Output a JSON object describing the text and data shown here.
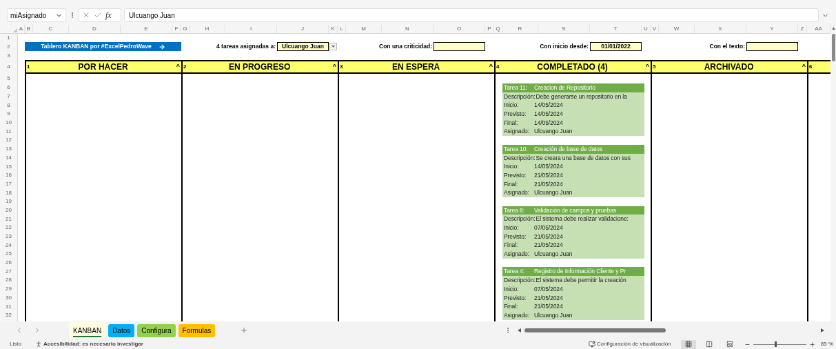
{
  "name_box": "miAsignado",
  "formula_bar": {
    "function_label": "fx",
    "value": "Ulcuango Juan"
  },
  "column_headers": [
    "A",
    "B",
    "C",
    "D",
    "E",
    "F",
    "G",
    "H",
    "I",
    "J",
    "K",
    "L",
    "M",
    "N",
    "O",
    "P",
    "Q",
    "R",
    "S",
    "T",
    "U",
    "V",
    "W",
    "X",
    "Y",
    "Z",
    "AA"
  ],
  "row_headers": [
    "1",
    "2",
    "3",
    "4",
    "5",
    "6",
    "7",
    "8",
    "9",
    "10",
    "11",
    "12",
    "13",
    "14",
    "15",
    "16",
    "17",
    "18",
    "19",
    "20",
    "21",
    "22",
    "23",
    "24",
    "25",
    "26",
    "27",
    "28",
    "29",
    "30",
    "31",
    "32"
  ],
  "banner": "Tablero KANBAN por #ExcelPedroWave",
  "filters": [
    {
      "kind": "dropdown",
      "label": "4 tareas asignadas a:",
      "value": "Ulcuango Juan"
    },
    {
      "kind": "field",
      "label": "Con una criticidad:"
    },
    {
      "kind": "field",
      "label": "Con inicio desde:",
      "value": "01/01/2022"
    },
    {
      "kind": "field",
      "label": "Con el texto:"
    }
  ],
  "board": [
    {
      "number": "1",
      "title": "POR HACER",
      "toggle": "^"
    },
    {
      "number": "2",
      "title": "EN PROGRESO",
      "toggle": "^"
    },
    {
      "number": "3",
      "title": "EN ESPERA",
      "toggle": "^"
    },
    {
      "number": "4",
      "title": "COMPLETADO (4)",
      "toggle": "^",
      "cards": [
        {
          "task": "Tarea 11:",
          "title": "Creacion de Repositorio",
          "fields": [
            {
              "label": "Descripción:",
              "value": "Debe generarse un repositorio en la"
            },
            {
              "label": "Inicio:",
              "value": "14/05/2024"
            },
            {
              "label": "Previsto:",
              "value": "14/05/2024"
            },
            {
              "label": "Final:",
              "value": "14/05/2024"
            },
            {
              "label": "Asignado:",
              "value": "Ulcuango Juan"
            }
          ]
        },
        {
          "task": "Tarea 10:",
          "title": "Creación de base de datos",
          "fields": [
            {
              "label": "Descripción:",
              "value": "Se creara una base de datos con sus"
            },
            {
              "label": "Inicio:",
              "value": "14/05/2024"
            },
            {
              "label": "Previsto:",
              "value": "21/05/2024"
            },
            {
              "label": "Final:",
              "value": "21/05/2024"
            },
            {
              "label": "Asignado:",
              "value": "Ulcuango Juan"
            }
          ]
        },
        {
          "task": "Tarea 8:",
          "title": "Validación de campos y pruebas",
          "fields": [
            {
              "label": "Descripción:",
              "value": "El sistema debe realizar validacione:"
            },
            {
              "label": "Inicio:",
              "value": "07/05/2024"
            },
            {
              "label": "Previsto:",
              "value": "21/05/2024"
            },
            {
              "label": "Final:",
              "value": "21/05/2024"
            },
            {
              "label": "Asignado:",
              "value": "Ulcuango Juan"
            }
          ]
        },
        {
          "task": "Tarea 4:",
          "title": "Registro de Información Cliente y Pr",
          "fields": [
            {
              "label": "Descripción:",
              "value": "El sistema debe permitir la creación"
            },
            {
              "label": "Inicio:",
              "value": "07/05/2024"
            },
            {
              "label": "Previsto:",
              "value": "21/05/2024"
            },
            {
              "label": "Final:",
              "value": "21/05/2024"
            },
            {
              "label": "Asignado:",
              "value": "Ulcuango Juan"
            }
          ]
        }
      ]
    },
    {
      "number": "5",
      "title": "ARCHIVADO",
      "toggle": "^"
    },
    {
      "number": "6"
    }
  ],
  "sheet_tabs": [
    {
      "label": "KANBAN",
      "selected": true
    },
    {
      "label": "Datos",
      "selected": false,
      "color": "#00b0f0"
    },
    {
      "label": "Configura",
      "selected": false,
      "color": "#92d050"
    },
    {
      "label": "Formulas",
      "selected": false,
      "color": "#ffc000"
    }
  ],
  "status_bar": {
    "state": "Listo",
    "accessibility": "Accesibilidad: es necesario investigar",
    "display_settings": "Configuración de visualización",
    "views": [
      {
        "kind": "normal",
        "selected": true
      },
      {
        "kind": "page-layout",
        "selected": false
      },
      {
        "kind": "page-break",
        "selected": false
      }
    ],
    "zoom_slider": {
      "level": 0.43
    },
    "zoom": "85 %"
  }
}
